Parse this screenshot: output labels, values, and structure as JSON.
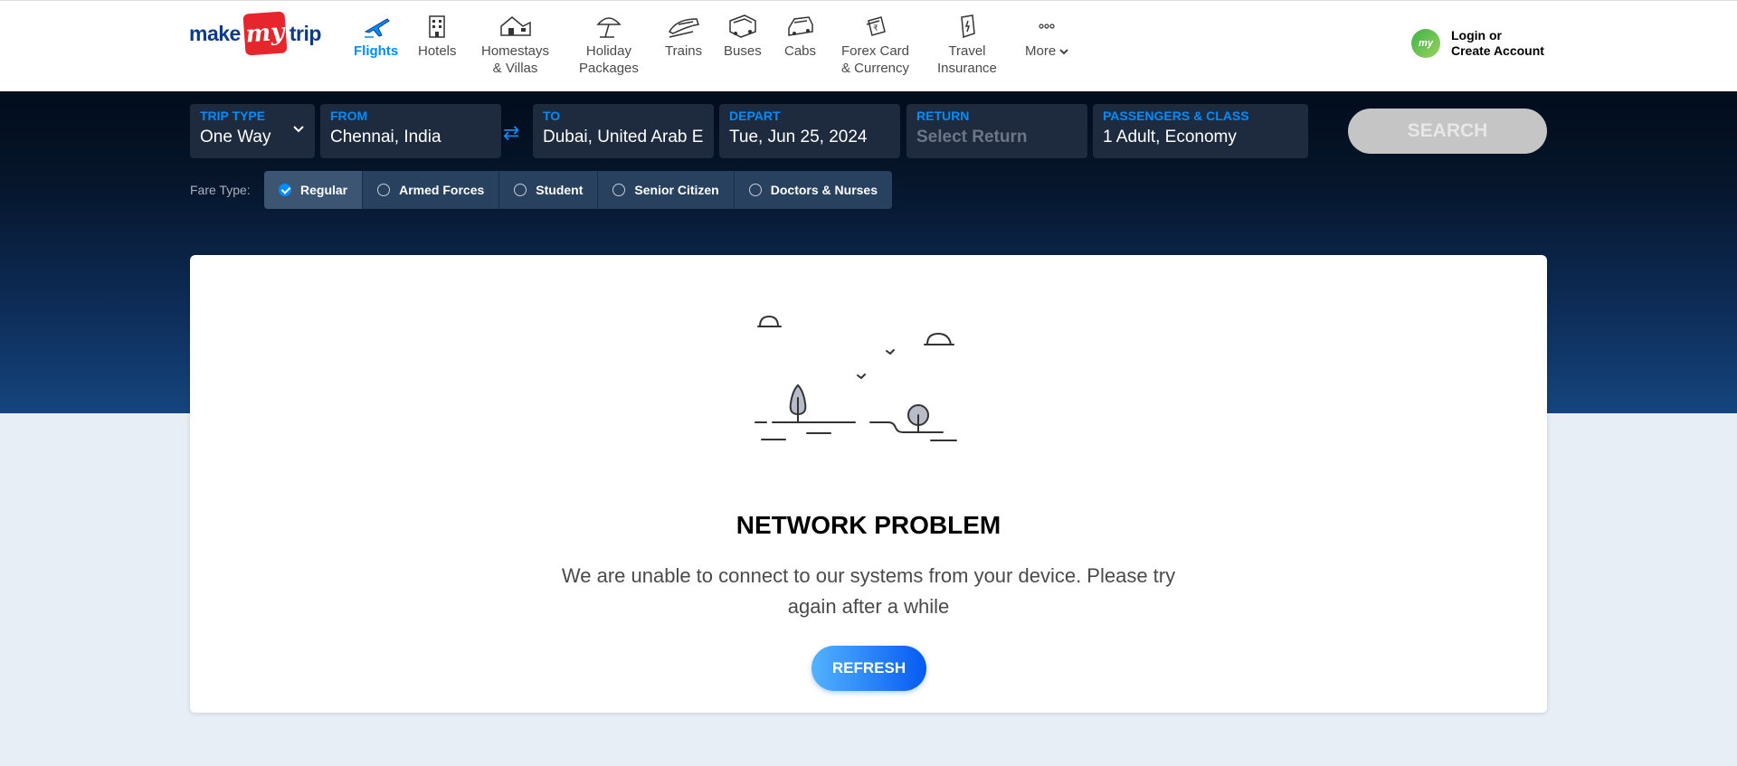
{
  "logo": {
    "make": "make",
    "my": "my",
    "trip": "trip"
  },
  "nav": [
    {
      "label": "Flights",
      "icon": "plane-icon"
    },
    {
      "label": "Hotels",
      "icon": "hotel-icon"
    },
    {
      "label_line1": "Homestays",
      "label_line2": "& Villas",
      "icon": "villa-icon"
    },
    {
      "label_line1": "Holiday",
      "label_line2": "Packages",
      "icon": "umbrella-icon"
    },
    {
      "label": "Trains",
      "icon": "train-icon"
    },
    {
      "label": "Buses",
      "icon": "bus-icon"
    },
    {
      "label": "Cabs",
      "icon": "cab-icon"
    },
    {
      "label_line1": "Forex Card",
      "label_line2": "& Currency",
      "icon": "forex-icon"
    },
    {
      "label_line1": "Travel",
      "label_line2": "Insurance",
      "icon": "insurance-icon"
    },
    {
      "label": "More",
      "icon": "more-icon"
    }
  ],
  "login": {
    "avatar": "my",
    "line1": "Login or",
    "line2": "Create Account"
  },
  "search": {
    "trip_type": {
      "label": "TRIP TYPE",
      "value": "One Way"
    },
    "from": {
      "label": "FROM",
      "value": "Chennai, India"
    },
    "to": {
      "label": "TO",
      "value": "Dubai, United Arab Emirates"
    },
    "depart": {
      "label": "DEPART",
      "value": "Tue, Jun 25, 2024"
    },
    "return": {
      "label": "RETURN",
      "placeholder": "Select Return"
    },
    "passengers": {
      "label": "PASSENGERS & CLASS",
      "value": "1 Adult, Economy"
    },
    "button": "SEARCH"
  },
  "fare": {
    "label": "Fare Type:",
    "options": [
      "Regular",
      "Armed Forces",
      "Student",
      "Senior Citizen",
      "Doctors & Nurses"
    ],
    "selected": "Regular"
  },
  "error": {
    "title": "NETWORK PROBLEM",
    "message": "We are unable to connect to our systems from your device. Please try again after a while",
    "button": "REFRESH"
  },
  "colors": {
    "accent": "#008cff",
    "brand_red": "#e6262c",
    "hero_dark": "#020d1d",
    "hero_light": "#15457e"
  }
}
